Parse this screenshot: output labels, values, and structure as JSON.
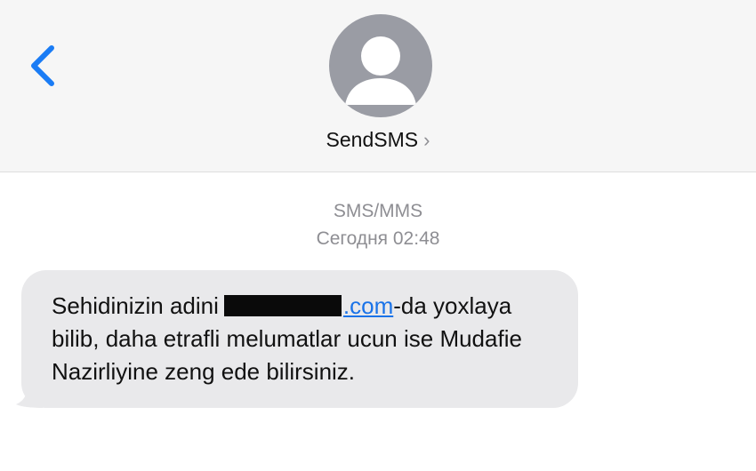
{
  "header": {
    "back_icon": "chevron-left-icon",
    "avatar_icon": "person-silhouette-icon",
    "contact_name": "SendSMS",
    "contact_chevron": "›",
    "accent_color": "#1a7cf5"
  },
  "thread": {
    "service_label": "SMS/MMS",
    "timestamp": "Сегодня 02:48"
  },
  "message": {
    "text_before_link": "Sehidinizin adini",
    "link_visible_suffix": ".com",
    "text_after_link": "-da yoxlaya bilib, daha etrafli melumatlar ucun ise Mudafie Nazirliyine zeng ede bilirsiniz.",
    "bubble_color": "#e9e9eb",
    "link_color": "#1a73e8"
  }
}
